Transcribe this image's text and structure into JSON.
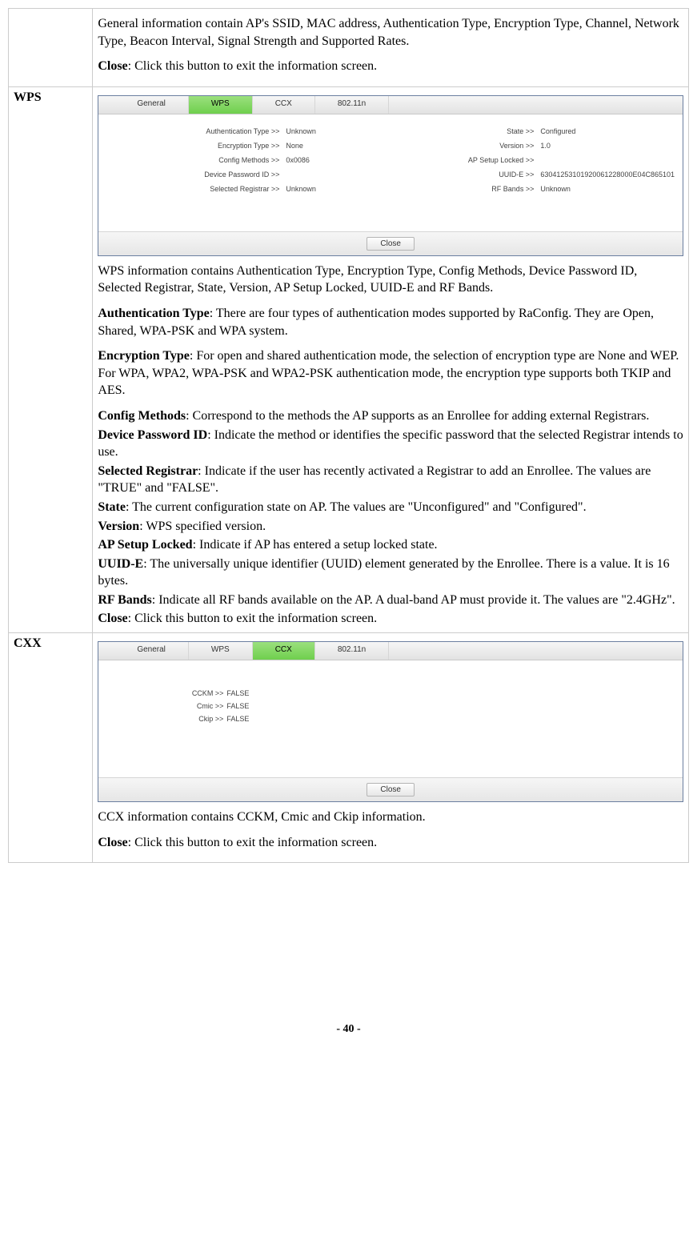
{
  "row_general": {
    "desc": "General information contain AP's SSID, MAC address, Authentication Type, Encryption Type, Channel, Network Type, Beacon Interval, Signal Strength and Supported Rates.",
    "close_label": "Close",
    "close_desc": ": Click this button to exit the information screen."
  },
  "row_wps": {
    "label": "WPS",
    "tabs": {
      "general": "General",
      "wps": "WPS",
      "ccx": "CCX",
      "n": "802.11n"
    },
    "fields": {
      "auth_type_l": "Authentication Type >>",
      "auth_type_v": "Unknown",
      "state_l": "State >>",
      "state_v": "Configured",
      "enc_type_l": "Encryption Type >>",
      "enc_type_v": "None",
      "version_l": "Version >>",
      "version_v": "1.0",
      "cfg_l": "Config Methods >>",
      "cfg_v": "0x0086",
      "aplock_l": "AP Setup Locked >>",
      "aplock_v": "",
      "dpw_l": "Device Password ID >>",
      "dpw_v": "",
      "uuid_l": "UUID-E >>",
      "uuid_v": "63041253101920061228000E04C865101",
      "sr_l": "Selected Registrar >>",
      "sr_v": "Unknown",
      "rf_l": "RF Bands >>",
      "rf_v": "Unknown"
    },
    "close_btn": "Close",
    "desc_intro": "WPS information contains Authentication Type, Encryption Type, Config Methods, Device Password ID, Selected Registrar, State, Version, AP Setup Locked, UUID-E and RF Bands.",
    "auth_t": "Authentication Type",
    "auth_d": ": There are four types of authentication modes supported by RaConfig. They are Open, Shared, WPA-PSK and WPA system.",
    "enc_t": "Encryption Type",
    "enc_d": ": For open and shared authentication mode, the selection of encryption type are None and WEP. For WPA, WPA2, WPA-PSK and WPA2-PSK authentication mode, the encryption type supports both TKIP and AES.",
    "cfg_t": "Config Methods",
    "cfg_d": ": Correspond to the methods the AP supports as an Enrollee for adding external Registrars.",
    "dpw_t": "Device Password ID",
    "dpw_d": ": Indicate the method or identifies the specific password that the selected Registrar intends to use.",
    "sr_t": "Selected Registrar",
    "sr_d": ": Indicate if the user has recently activated a Registrar to add an Enrollee. The values are \"TRUE\" and \"FALSE\".",
    "state_t": "State",
    "state_d": ": The current configuration state on AP. The values are \"Unconfigured\" and \"Configured\".",
    "ver_t": "Version",
    "ver_d": ": WPS specified version.",
    "apl_t": "AP Setup Locked",
    "apl_d": ": Indicate if AP has entered a setup locked state.",
    "uuid_t": "UUID-E",
    "uuid_d": ": The universally unique identifier (UUID) element generated by the Enrollee. There is a value. It is 16 bytes.",
    "rf_t": "RF Bands",
    "rf_d": ": Indicate all RF bands available on the AP. A dual-band AP must provide it. The values are \"2.4GHz\".",
    "close_t": "Close",
    "close_d": ": Click this button to exit the information screen."
  },
  "row_cxx": {
    "label": "CXX",
    "tabs": {
      "general": "General",
      "wps": "WPS",
      "ccx": "CCX",
      "n": "802.11n"
    },
    "fields": {
      "cckm_l": "CCKM >>",
      "cckm_v": "FALSE",
      "cmic_l": "Cmic >>",
      "cmic_v": "FALSE",
      "ckip_l": "Ckip >>",
      "ckip_v": "FALSE"
    },
    "close_btn": "Close",
    "desc": "CCX information contains CCKM, Cmic and Ckip information.",
    "close_t": "Close",
    "close_d": ": Click this button to exit the information screen."
  },
  "page_number": "- 40 -"
}
